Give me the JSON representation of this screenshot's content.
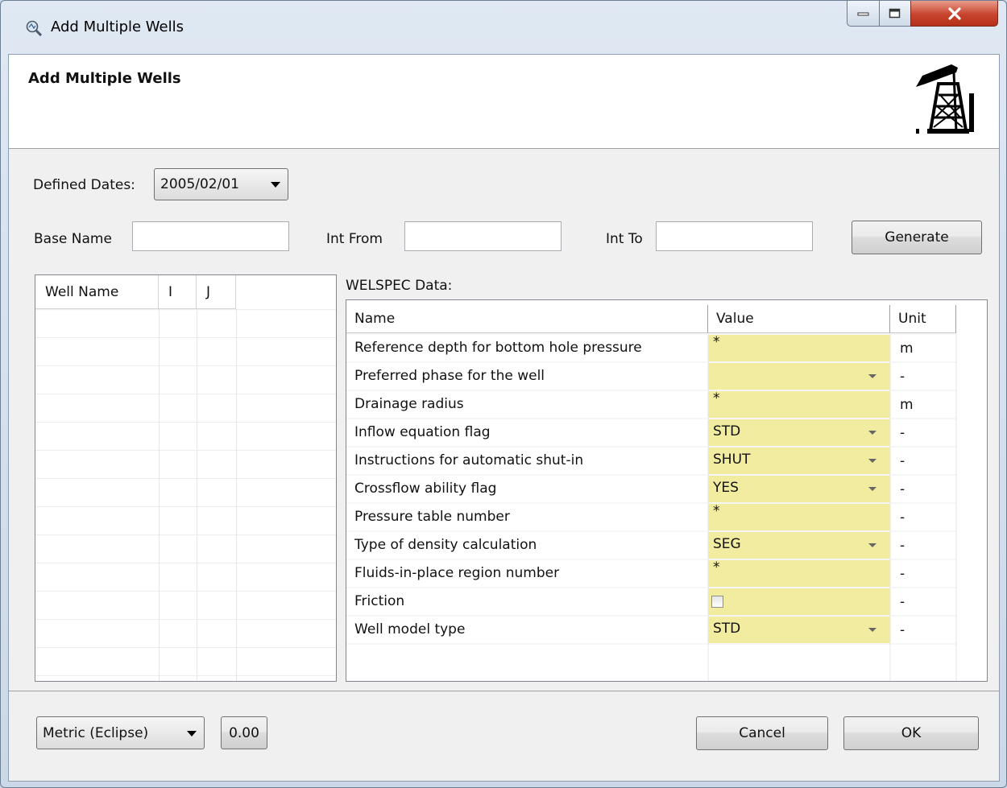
{
  "window": {
    "title": "Add Multiple Wells",
    "header_title": "Add Multiple Wells"
  },
  "dates": {
    "label": "Defined Dates:",
    "selected": "2005/02/01"
  },
  "naming": {
    "base_name_label": "Base Name",
    "base_name_value": "",
    "int_from_label": "Int From",
    "int_from_value": "",
    "int_to_label": "Int To",
    "int_to_value": "",
    "generate_label": "Generate"
  },
  "well_table": {
    "columns": [
      "Well Name",
      "I",
      "J"
    ],
    "rows": []
  },
  "welspec": {
    "label": "WELSPEC Data:",
    "columns": [
      "Name",
      "Value",
      "Unit"
    ],
    "rows": [
      {
        "name": "Reference depth for bottom hole pressure",
        "value": "*",
        "unit": "m",
        "kind": "text"
      },
      {
        "name": "Preferred phase for the well",
        "value": "",
        "unit": "-",
        "kind": "dropdown"
      },
      {
        "name": "Drainage radius",
        "value": "*",
        "unit": "m",
        "kind": "text"
      },
      {
        "name": "Inflow equation flag",
        "value": "STD",
        "unit": "-",
        "kind": "dropdown"
      },
      {
        "name": "Instructions for automatic shut-in",
        "value": "SHUT",
        "unit": "-",
        "kind": "dropdown"
      },
      {
        "name": "Crossflow ability flag",
        "value": "YES",
        "unit": "-",
        "kind": "dropdown"
      },
      {
        "name": "Pressure table number",
        "value": "*",
        "unit": "-",
        "kind": "text"
      },
      {
        "name": "Type of density calculation",
        "value": "SEG",
        "unit": "-",
        "kind": "dropdown"
      },
      {
        "name": "Fluids-in-place region number",
        "value": "*",
        "unit": "-",
        "kind": "text"
      },
      {
        "name": "Friction",
        "value": "",
        "unit": "-",
        "kind": "checkbox"
      },
      {
        "name": "Well model type",
        "value": "STD",
        "unit": "-",
        "kind": "dropdown"
      }
    ]
  },
  "footer": {
    "units_selected": "Metric (Eclipse)",
    "numeric_value": "0.00",
    "cancel_label": "Cancel",
    "ok_label": "OK"
  },
  "colors": {
    "value_cell": "#f2eca0",
    "close_button": "#c8442e"
  }
}
